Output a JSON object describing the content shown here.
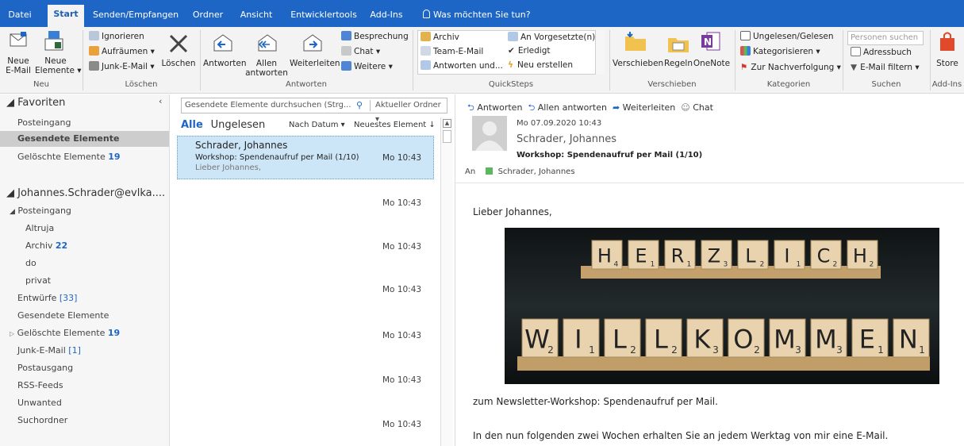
{
  "tabs": [
    "Datei",
    "Start",
    "Senden/Empfangen",
    "Ordner",
    "Ansicht",
    "Entwicklertools",
    "Add-Ins"
  ],
  "tellme": "Was möchten Sie tun?",
  "ribbon": {
    "neu": {
      "new_email_line1": "Neue",
      "new_email_line2": "E-Mail",
      "new_items_line1": "Neue",
      "new_items_line2": "Elemente",
      "label": "Neu"
    },
    "loeschen": {
      "ignore": "Ignorieren",
      "cleanup": "Aufräumen",
      "junk": "Junk-E-Mail",
      "delete": "Löschen",
      "label": "Löschen"
    },
    "antworten": {
      "reply": "Antworten",
      "reply_all_line1": "Allen",
      "reply_all_line2": "antworten",
      "forward": "Weiterleiten",
      "meeting": "Besprechung",
      "chat": "Chat",
      "more": "Weitere",
      "label": "Antworten"
    },
    "quicksteps": {
      "archive": "Archiv",
      "team": "Team-E-Mail",
      "reply_delete": "Antworten und...",
      "to_manager": "An Vorgesetzte(n)",
      "done": "Erledigt",
      "create_new": "Neu erstellen",
      "label": "QuickSteps"
    },
    "verschieben": {
      "move": "Verschieben",
      "rules": "Regeln",
      "onenote": "OneNote",
      "label": "Verschieben"
    },
    "kategorien": {
      "unread_read": "Ungelesen/Gelesen",
      "categorize": "Kategorisieren",
      "followup": "Zur Nachverfolgung",
      "label": "Kategorien"
    },
    "suchen": {
      "people_placeholder": "Personen suchen",
      "addressbook": "Adressbuch",
      "filter": "E-Mail filtern",
      "label": "Suchen"
    },
    "addins": {
      "store": "Store",
      "label": "Add-Ins"
    }
  },
  "folders": {
    "favorites_header": "Favoriten",
    "favorites": [
      {
        "name": "Posteingang",
        "count": ""
      },
      {
        "name": "Gesendete Elemente",
        "count": ""
      },
      {
        "name": "Gelöschte Elemente",
        "count": "19"
      }
    ],
    "account_header": "Johannes.Schrader@evlka....",
    "inbox": "Posteingang",
    "inbox_sub": [
      {
        "name": "Altruja",
        "count": ""
      },
      {
        "name": "Archiv",
        "count": "22"
      },
      {
        "name": "do",
        "count": ""
      },
      {
        "name": "privat",
        "count": ""
      }
    ],
    "drafts": "Entwürfe",
    "drafts_count": "[33]",
    "sent": "Gesendete Elemente",
    "deleted": "Gelöschte Elemente",
    "deleted_count": "19",
    "junk": "Junk-E-Mail",
    "junk_count": "[1]",
    "outbox": "Postausgang",
    "rss": "RSS-Feeds",
    "unwanted": "Unwanted",
    "search_folders": "Suchordner"
  },
  "msglist": {
    "search_placeholder": "Gesendete Elemente durchsuchen (Strg...",
    "scope": "Aktueller Ordner",
    "filter_all": "Alle",
    "filter_unread": "Ungelesen",
    "sort_by": "Nach Datum",
    "sort_order": "Neuestes Element",
    "selected": {
      "sender": "Schrader, Johannes",
      "subject": "Workshop: Spendenaufruf per Mail (1/10)",
      "preview": "Lieber Johannes,",
      "time": "Mo 10:43"
    },
    "times": [
      "Mo 10:43",
      "Mo 10:43",
      "Mo 10:43",
      "Mo 10:43",
      "Mo 10:43",
      "Mo 10:43",
      "Mo 10:43"
    ]
  },
  "reading": {
    "actions": [
      "Antworten",
      "Allen antworten",
      "Weiterleiten",
      "Chat"
    ],
    "date": "Mo 07.09.2020 10:43",
    "sender": "Schrader, Johannes",
    "subject": "Workshop: Spendenaufruf per Mail (1/10)",
    "to_label": "An",
    "to": "Schrader, Johannes",
    "greeting": "Lieber Johannes,",
    "photo_row1": [
      "H",
      "E",
      "R",
      "Z",
      "L",
      "I",
      "C",
      "H"
    ],
    "photo_row1_sub": [
      "4",
      "1",
      "1",
      "3",
      "2",
      "1",
      "2",
      "2"
    ],
    "photo_row2": [
      "W",
      "I",
      "L",
      "L",
      "K",
      "O",
      "M",
      "M",
      "E",
      "N"
    ],
    "photo_row2_sub": [
      "2",
      "1",
      "2",
      "2",
      "3",
      "2",
      "3",
      "3",
      "1",
      "1"
    ],
    "line1": "zum Newsletter-Workshop: Spendenaufruf per Mail.",
    "line2": "In den nun folgenden zwei Wochen erhalten Sie an jedem Werktag von mir eine E-Mail."
  },
  "colors": {
    "accent": "#1e66c6",
    "selection": "#cde6f7",
    "category_green": "#5cb85c"
  }
}
